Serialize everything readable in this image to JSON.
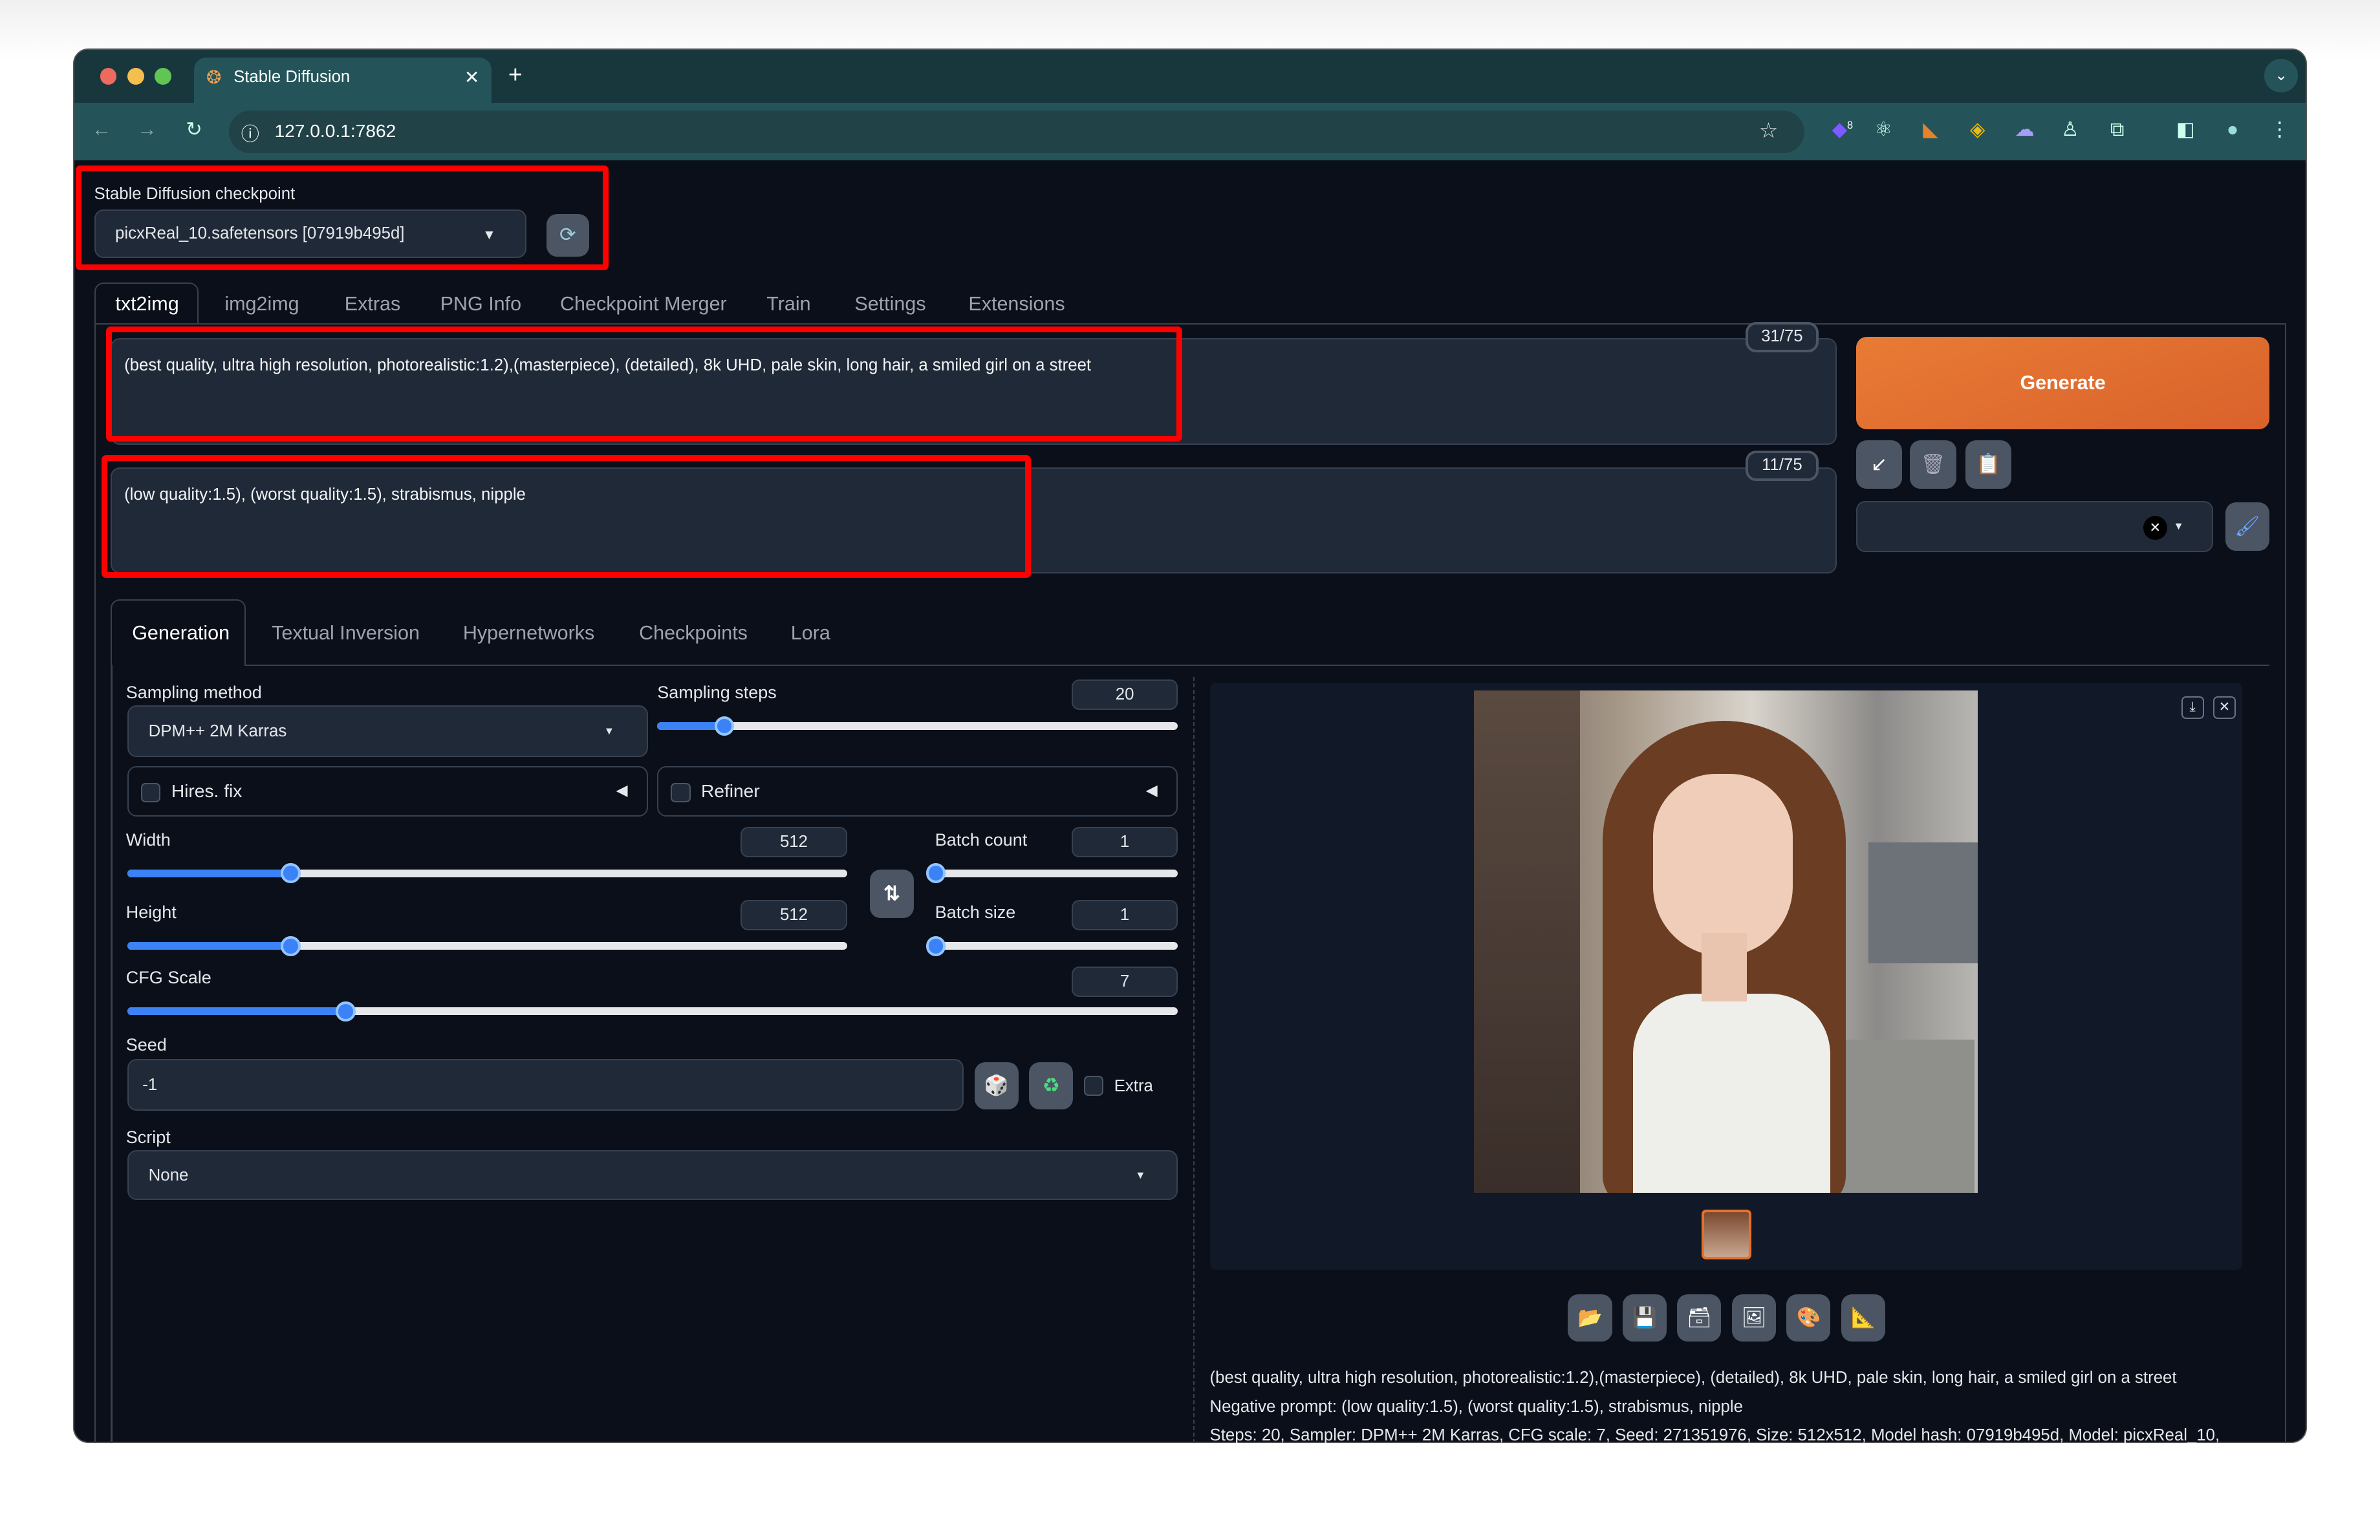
{
  "browser": {
    "tab_title": "Stable Diffusion",
    "url": "127.0.0.1:7862",
    "extension_badge": "8",
    "colors": {
      "tabbar": "#17373d",
      "toolbar": "#245459"
    }
  },
  "checkpoint": {
    "label": "Stable Diffusion checkpoint",
    "value": "picxReal_10.safetensors [07919b495d]"
  },
  "main_tabs": [
    "txt2img",
    "img2img",
    "Extras",
    "PNG Info",
    "Checkpoint Merger",
    "Train",
    "Settings",
    "Extensions"
  ],
  "prompt": {
    "value": "(best quality, ultra high resolution, photorealistic:1.2),(masterpiece), (detailed), 8k UHD, pale skin, long hair,  a smiled girl on a street",
    "counter": "31/75"
  },
  "negative_prompt": {
    "value": "(low quality:1.5), (worst quality:1.5), strabismus, nipple",
    "counter": "11/75"
  },
  "generate_label": "Generate",
  "accent_color": "#e8702a",
  "sub_tabs": [
    "Generation",
    "Textual Inversion",
    "Hypernetworks",
    "Checkpoints",
    "Lora"
  ],
  "params": {
    "sampling_method": {
      "label": "Sampling method",
      "value": "DPM++ 2M Karras"
    },
    "sampling_steps": {
      "label": "Sampling steps",
      "value": "20",
      "min": 1,
      "max": 150
    },
    "hires_fix": "Hires. fix",
    "refiner": "Refiner",
    "width": {
      "label": "Width",
      "value": "512",
      "min": 64,
      "max": 2048
    },
    "height": {
      "label": "Height",
      "value": "512",
      "min": 64,
      "max": 2048
    },
    "batch_count": {
      "label": "Batch count",
      "value": "1",
      "min": 1,
      "max": 100
    },
    "batch_size": {
      "label": "Batch size",
      "value": "1",
      "min": 1,
      "max": 8
    },
    "cfg_scale": {
      "label": "CFG Scale",
      "value": "7",
      "min": 1,
      "max": 30
    },
    "seed": {
      "label": "Seed",
      "value": "-1"
    },
    "extra": "Extra",
    "script": {
      "label": "Script",
      "value": "None"
    }
  },
  "output_info": {
    "line1": "(best quality, ultra high resolution, photorealistic:1.2),(masterpiece), (detailed), 8k UHD, pale skin, long hair, a smiled girl on a street",
    "line2": "Negative prompt: (low quality:1.5), (worst quality:1.5), strabismus, nipple",
    "line3": "Steps: 20, Sampler: DPM++ 2M Karras, CFG scale: 7, Seed: 271351976, Size: 512x512, Model hash: 07919b495d, Model: picxReal_10,"
  }
}
